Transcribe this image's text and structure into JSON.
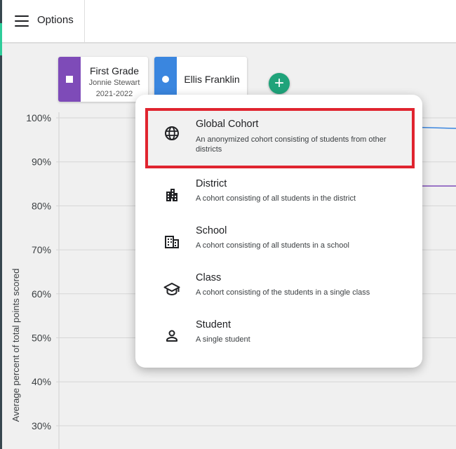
{
  "topbar": {
    "options_label": "Options"
  },
  "cohorts": [
    {
      "title": "First Grade",
      "teacher": "Jonnie Stewart",
      "year": "2021-2022",
      "color": "#7e4bb8"
    },
    {
      "title": "Ellis Franklin",
      "color": "#3a86df"
    }
  ],
  "add_button": {
    "glyph": "+",
    "color": "#1fa37a"
  },
  "chart_data": {
    "type": "line",
    "ylabel": "Average percent of total points scored",
    "yticks": [
      "100%",
      "90%",
      "80%",
      "70%",
      "60%",
      "50%",
      "40%",
      "30%"
    ],
    "ylim": [
      30,
      100
    ],
    "series": [
      {
        "color": "#3a86df",
        "values": [
          98,
          97.6
        ]
      },
      {
        "color": "#7e4bb8",
        "values": [
          84.5,
          84.5
        ]
      }
    ],
    "grid": true
  },
  "menu": {
    "items": [
      {
        "label": "Global Cohort",
        "desc": "An anonymized cohort consisting of students from other districts",
        "icon": "globe-icon",
        "selected": true
      },
      {
        "label": "District",
        "desc": "A cohort consisting of all students in the district",
        "icon": "apartment-building-icon"
      },
      {
        "label": "School",
        "desc": "A cohort consisting of all students in a school",
        "icon": "school-building-icon"
      },
      {
        "label": "Class",
        "desc": "A cohort consisting of the students in a single class",
        "icon": "graduation-cap-icon"
      },
      {
        "label": "Student",
        "desc": "A single student",
        "icon": "person-icon"
      }
    ]
  }
}
